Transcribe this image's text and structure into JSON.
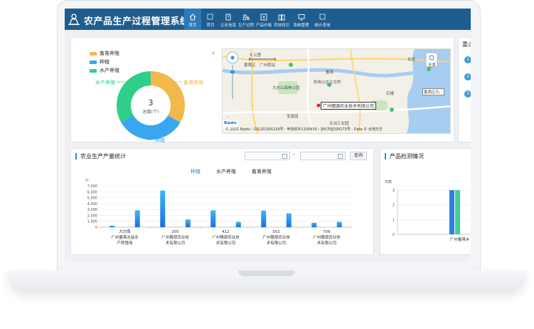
{
  "app": {
    "title": "农产品生产过程管理系统",
    "nav": [
      {
        "label": "首页",
        "icon": "home-icon",
        "active": true
      },
      {
        "label": "首页",
        "icon": "image-icon",
        "active": false
      },
      {
        "label": "企业信息",
        "icon": "building-icon",
        "active": false
      },
      {
        "label": "生产过程",
        "icon": "tractor-icon",
        "active": false
      },
      {
        "label": "产品价格",
        "icon": "yen-icon",
        "active": false
      },
      {
        "label": "农技知识",
        "icon": "book-icon",
        "active": false
      },
      {
        "label": "系统管理",
        "icon": "monitor-icon",
        "active": false
      },
      {
        "label": "统计查询",
        "icon": "image-icon",
        "active": false
      }
    ]
  },
  "overview": {
    "total_value": "3",
    "total_label": "总数(个)",
    "legend": [
      {
        "label": "畜禽养殖",
        "color": "#f2b84b"
      },
      {
        "label": "种植",
        "color": "#3aa6f0"
      },
      {
        "label": "水产养殖",
        "color": "#2fcf8a"
      }
    ],
    "callouts": {
      "livestock": "畜禽养殖",
      "planting": "种植",
      "aquaculture": "水产养殖"
    }
  },
  "map": {
    "copyright": "© 2021 Baidu - GS(2019)5218号 - 甲测资字1100930 - 京ICP证030173号 - Data © 长地万方",
    "marker_label": "广州穗源农业技术有限公司",
    "scale_label": "5 公里",
    "top_label": "广州南站",
    "poi_label": "番禺区石...",
    "quanjing": "全景",
    "places": [
      "番禺区",
      "大夫山森林公园",
      "番禺",
      "机电山庄立交桥",
      "宝墨园",
      "石楼",
      "五洲工业园",
      "化龙"
    ]
  },
  "side_panel": {
    "title": "重点",
    "items": [
      "1",
      "2",
      "3"
    ]
  },
  "production": {
    "title": "农业生产产量统计",
    "date_separator": "-",
    "query_label": "查询",
    "tabs": [
      "种植",
      "水产养殖",
      "畜禽养殖"
    ],
    "active_tab": "种植"
  },
  "inspection": {
    "title": "产品检测情况",
    "y_unit": "次数",
    "x_label": "广州番禺乡"
  },
  "chart_data": [
    {
      "type": "bar",
      "title": "",
      "ylabel": "斤",
      "ylim": [
        0,
        7000
      ],
      "yticks": [
        "0",
        "1,000",
        "2,000",
        "3,000",
        "4,000",
        "5,000",
        "6,000",
        "7,000"
      ],
      "x_tick_labels": [
        [
          "大白菜",
          "广州番禺水益永",
          "产养殖场"
        ],
        [
          "205",
          "广州穗源农业技",
          "术有限公司"
        ],
        [
          "412",
          "广州穗源农业技",
          "术有限公司"
        ],
        [
          "502",
          "广州穗源农业技",
          "术有限公司"
        ],
        [
          "706",
          "广州穗源农业技",
          "术有限公司"
        ]
      ],
      "values": [
        250,
        2850,
        6200,
        1300,
        2850,
        900,
        2800,
        2350,
        750,
        900
      ]
    },
    {
      "type": "bar",
      "title": "",
      "ylabel": "次数",
      "ylim": [
        0,
        3
      ],
      "yticks": [
        "0",
        "1",
        "2",
        "3"
      ],
      "categories": [
        "广州番禺乡"
      ],
      "series": [
        {
          "values": [
            3
          ],
          "color": "#2f7fe0"
        },
        {
          "values": [
            3
          ],
          "color": "#3fd19a"
        }
      ]
    }
  ]
}
